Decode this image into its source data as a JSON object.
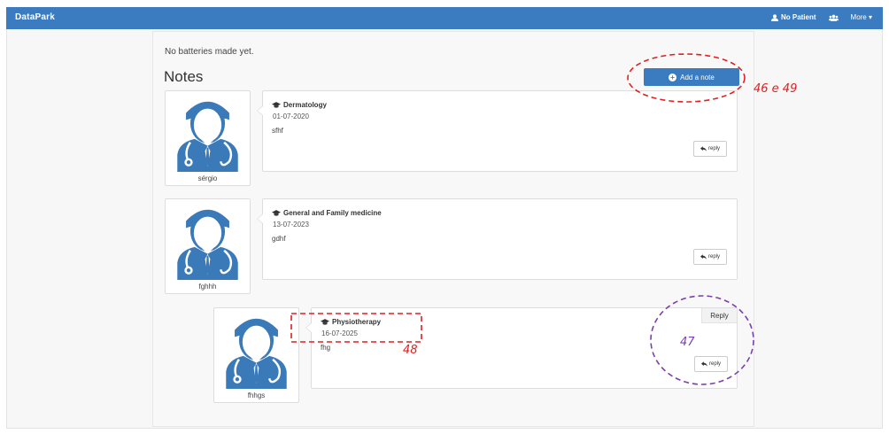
{
  "navbar": {
    "brand": "DataPark",
    "patient_label": "No Patient",
    "more_label": "More ▾"
  },
  "main": {
    "no_batteries_text": "No batteries made yet.",
    "notes_title": "Notes",
    "add_note_label": "Add a note"
  },
  "notes": [
    {
      "author": "sérgio",
      "specialty": "Dermatology",
      "date": "01-07-2020",
      "text": "sfhf",
      "reply_label": "reply"
    },
    {
      "author": "fghhh",
      "specialty": "General and Family medicine",
      "date": "13-07-2023",
      "text": "gdhf",
      "reply_label": "reply"
    }
  ],
  "reply_note": {
    "author": "fhhgs",
    "specialty": "Physiotherapy",
    "date": "16-07-2025",
    "text": "fhg",
    "tag_label": "Reply",
    "reply_label": "reply"
  },
  "annotations": {
    "add_note": "46 e 49",
    "specialty": "48",
    "reply": "47"
  },
  "colors": {
    "primary": "#3b7bbf",
    "avatar": "#3a7ab9",
    "red_annotation": "#e02020",
    "purple_annotation": "#7a40b0"
  },
  "icons": {
    "user": "user-icon",
    "users": "users-icon",
    "plus": "plus-circle-icon",
    "graduation": "graduation-cap-icon",
    "reply": "reply-arrow-icon"
  }
}
